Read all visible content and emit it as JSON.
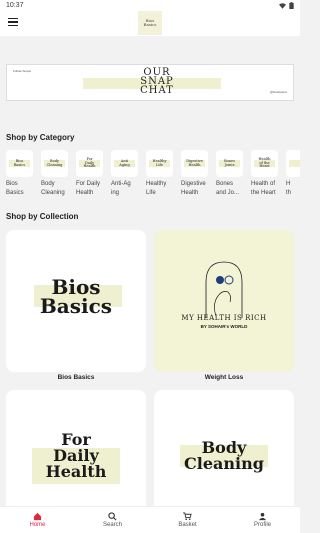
{
  "status": {
    "time": "10:37",
    "wifi_icon": "wifi-icon",
    "battery_icon": "battery-icon"
  },
  "appbar": {
    "menu_icon": "hamburger-menu-icon",
    "logo_text": "Bios\nBasics"
  },
  "banner": {
    "title": "OUR\nSNAP\nCHAT",
    "top_left_text": "Follow Snaps",
    "bottom_right_text": "@biosbasics"
  },
  "sections": {
    "category_title": "Shop by Category",
    "collection_title": "Shop by Collection"
  },
  "categories": [
    {
      "thumb": "Bios\nBasics",
      "label": "Bios\nBasics"
    },
    {
      "thumb": "Body\nCleaning",
      "label": "Body\nCleaning"
    },
    {
      "thumb": "For\nDaily\nHealth",
      "label": "For Daily\nHealth"
    },
    {
      "thumb": "Anti\nAging",
      "label": "Anti-Ag\ning"
    },
    {
      "thumb": "Healthy\nLife",
      "label": "Healthy\nLife"
    },
    {
      "thumb": "Digestive\nHealth",
      "label": "Digestive\nHealth"
    },
    {
      "thumb": "Bones\nJoints",
      "label": "Bones\nand Jo..."
    },
    {
      "thumb": "Health\nof the\nHeart",
      "label": "Health of\nthe Heart"
    },
    {
      "thumb": "",
      "label": "H\nth"
    }
  ],
  "collections": [
    {
      "card_text": "Bios\nBasics",
      "label": "Bios Basics"
    },
    {
      "card_title": "MY HEALTH IS RICH",
      "card_sub": "BY SOHAIR's WORLD",
      "label": "Weight Loss"
    },
    {
      "card_text": "For\nDaily\nHealth",
      "label": ""
    },
    {
      "card_text": "Body\nCleaning",
      "label": ""
    }
  ],
  "bottom_nav": [
    {
      "label": "Home",
      "icon": "home-icon",
      "active": true
    },
    {
      "label": "Search",
      "icon": "search-icon",
      "active": false
    },
    {
      "label": "Basket",
      "icon": "cart-icon",
      "active": false
    },
    {
      "label": "Profile",
      "icon": "profile-icon",
      "active": false
    }
  ],
  "colors": {
    "accent": "#e0283c",
    "highlight": "#eff0cf",
    "alt_card": "#f3f3d6"
  }
}
